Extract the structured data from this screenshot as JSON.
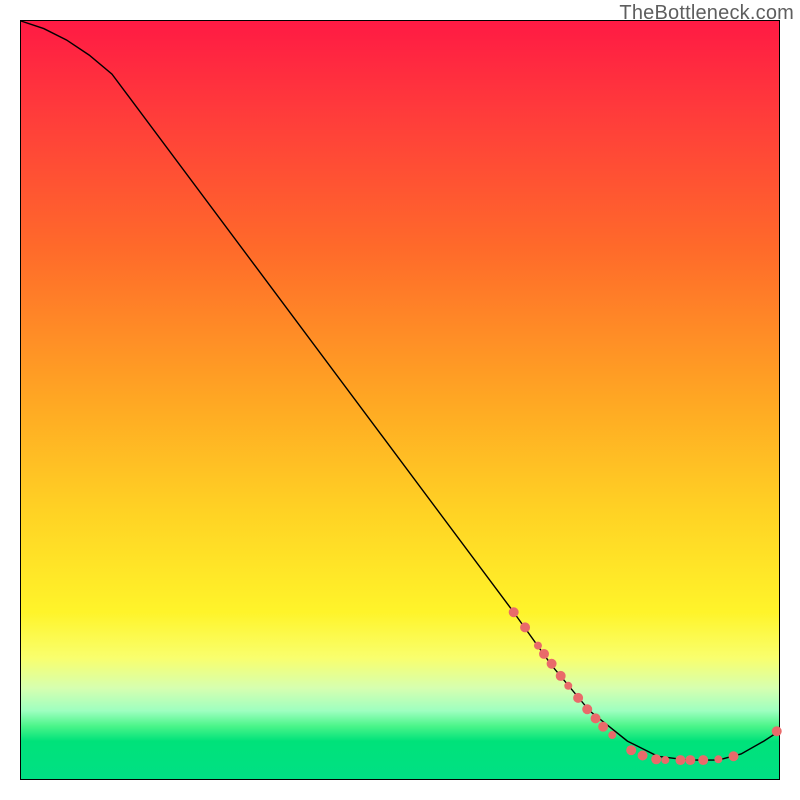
{
  "watermark": "TheBottleneck.com",
  "chart_data": {
    "type": "line",
    "title": "",
    "xlabel": "",
    "ylabel": "",
    "xlim": [
      0,
      100
    ],
    "ylim": [
      0,
      100
    ],
    "grid": false,
    "curve": [
      {
        "x": 0,
        "y": 100
      },
      {
        "x": 3,
        "y": 99
      },
      {
        "x": 6,
        "y": 97.5
      },
      {
        "x": 9,
        "y": 95.5
      },
      {
        "x": 12,
        "y": 93
      },
      {
        "x": 65,
        "y": 22
      },
      {
        "x": 70,
        "y": 15
      },
      {
        "x": 75,
        "y": 9
      },
      {
        "x": 80,
        "y": 5
      },
      {
        "x": 84,
        "y": 3
      },
      {
        "x": 88,
        "y": 2.5
      },
      {
        "x": 92,
        "y": 2.5
      },
      {
        "x": 95,
        "y": 3.3
      },
      {
        "x": 98,
        "y": 5
      },
      {
        "x": 100,
        "y": 6.3
      }
    ],
    "markers": [
      {
        "x": 65.0,
        "y": 22.0,
        "r": 5
      },
      {
        "x": 66.5,
        "y": 20.0,
        "r": 5
      },
      {
        "x": 68.2,
        "y": 17.6,
        "r": 4
      },
      {
        "x": 69.0,
        "y": 16.5,
        "r": 5
      },
      {
        "x": 70.0,
        "y": 15.2,
        "r": 5
      },
      {
        "x": 71.2,
        "y": 13.6,
        "r": 5
      },
      {
        "x": 72.2,
        "y": 12.3,
        "r": 4
      },
      {
        "x": 73.5,
        "y": 10.7,
        "r": 5
      },
      {
        "x": 74.7,
        "y": 9.2,
        "r": 5
      },
      {
        "x": 75.8,
        "y": 8.0,
        "r": 5
      },
      {
        "x": 76.8,
        "y": 6.9,
        "r": 5
      },
      {
        "x": 78.0,
        "y": 5.8,
        "r": 4
      },
      {
        "x": 80.5,
        "y": 3.8,
        "r": 5
      },
      {
        "x": 82.0,
        "y": 3.1,
        "r": 5
      },
      {
        "x": 83.8,
        "y": 2.6,
        "r": 5
      },
      {
        "x": 85.0,
        "y": 2.5,
        "r": 4
      },
      {
        "x": 87.0,
        "y": 2.5,
        "r": 5
      },
      {
        "x": 88.3,
        "y": 2.5,
        "r": 5
      },
      {
        "x": 90.0,
        "y": 2.5,
        "r": 5
      },
      {
        "x": 92.0,
        "y": 2.6,
        "r": 4
      },
      {
        "x": 94.0,
        "y": 3.0,
        "r": 5
      },
      {
        "x": 99.7,
        "y": 6.3,
        "r": 5
      }
    ],
    "colors": {
      "curve": "#000000",
      "marker": "#e96a6a",
      "bg_top": "#ff1a44",
      "bg_bottom": "#00e084"
    }
  }
}
